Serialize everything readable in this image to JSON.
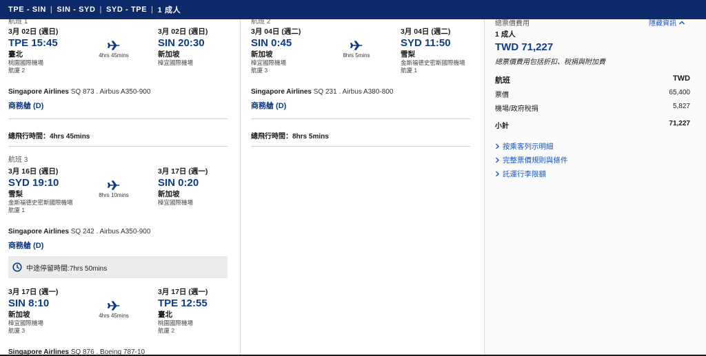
{
  "header": {
    "routes": [
      "TPE - SIN",
      "SIN - SYD",
      "SYD - TPE"
    ],
    "pax": "1 成人"
  },
  "flights": {
    "f1": {
      "label": "航班 1",
      "dep_date": "3月 02日 (週日)",
      "dep_time": "TPE 15:45",
      "dep_city": "臺北",
      "dep_airport": "桃園國際機場",
      "dep_terminal": "航廈 2",
      "arr_date": "3月 02日 (週日)",
      "arr_time": "SIN 20:30",
      "arr_city": "新加坡",
      "arr_airport": "樟宜國際機場",
      "duration": "4hrs 45mins",
      "airline": "Singapore Airlines",
      "flight_info": " SQ 873 . Airbus A350-900",
      "cabin": "商務艙 (D)",
      "total_label": "總飛行時間：",
      "total_value": "4hrs 45mins"
    },
    "f2": {
      "label": "航班 2",
      "dep_date": "3月 04日 (週二)",
      "dep_time": "SIN 0:45",
      "dep_city": "新加坡",
      "dep_airport": "樟宜國際機場",
      "dep_terminal": "航廈 3",
      "arr_date": "3月 04日 (週二)",
      "arr_time": "SYD 11:50",
      "arr_city": "雪梨",
      "arr_airport": "金斯福德史密斯國際機場",
      "arr_terminal": "航廈 1",
      "duration": "8hrs 5mins",
      "airline": "Singapore Airlines",
      "flight_info": " SQ 231 . Airbus A380-800",
      "cabin": "商務艙 (D)",
      "total_label": "總飛行時間：",
      "total_value": "8hrs 5mins"
    },
    "f3a": {
      "label": "航班 3",
      "dep_date": "3月 16日 (週日)",
      "dep_time": "SYD 19:10",
      "dep_city": "雪梨",
      "dep_airport": "金斯福德史密斯國際機場",
      "dep_terminal": "航廈 1",
      "arr_date": "3月 17日 (週一)",
      "arr_time": "SIN 0:20",
      "arr_city": "新加坡",
      "arr_airport": "樟宜國際機場",
      "duration": "8hrs 10mins",
      "airline": "Singapore Airlines",
      "flight_info": " SQ 242 . Airbus A350-900",
      "cabin": "商務艙 (D)"
    },
    "layover": "中途停留時間:7hrs 50mins",
    "f3b": {
      "dep_date": "3月 17日 (週一)",
      "dep_time": "SIN 8:10",
      "dep_city": "新加坡",
      "dep_airport": "樟宜國際機場",
      "dep_terminal": "航廈 3",
      "arr_date": "3月 17日 (週一)",
      "arr_time": "TPE 12:55",
      "arr_city": "臺北",
      "arr_airport": "桃園國際機場",
      "arr_terminal": "航廈 2",
      "duration": "4hrs 45mins",
      "airline": "Singapore Airlines",
      "flight_info": " SQ 876 . Boeing 787-10"
    }
  },
  "price": {
    "title": "總票價費用",
    "hide_link": "隱藏資訊",
    "pax": "1 成人",
    "total": "TWD 71,227",
    "note": "總票價費用包括折扣、稅捐與附加費",
    "header_label": "航班",
    "header_currency": "TWD",
    "fare_label": "票價",
    "fare_value": "65,400",
    "tax_label": "機場/政府稅捐",
    "tax_value": "5,827",
    "subtotal_label": "小計",
    "subtotal_value": "71,227",
    "links": [
      "按乘客列示明細",
      "完整票價規則與條件",
      "託運行李限額"
    ]
  },
  "colors": {
    "header_bg": "#0d2b6b",
    "accent": "#0d3a8a",
    "link": "#1a56c4",
    "layover_bg": "#ececec"
  },
  "icons": [
    "airplane-icon",
    "clock-icon",
    "chevron-up-icon",
    "chevron-right-icon"
  ]
}
